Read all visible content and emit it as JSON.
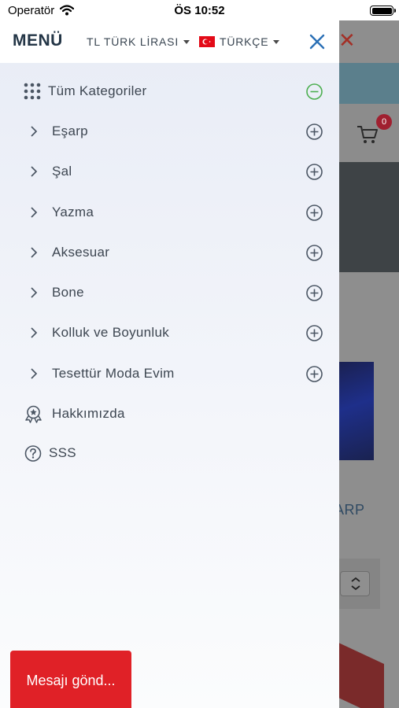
{
  "status_bar": {
    "carrier": "Operatör",
    "time": "ÖS 10:52"
  },
  "drawer": {
    "title": "MENÜ",
    "currency_label": "TL TÜRK LİRASI",
    "language_label": "TÜRKÇE",
    "items": [
      {
        "label": "Tüm Kategoriler",
        "icon": "grid-icon",
        "expanded": true
      },
      {
        "label": "Eşarp",
        "icon": "chevron-right-icon",
        "expanded": false
      },
      {
        "label": "Şal",
        "icon": "chevron-right-icon",
        "expanded": false
      },
      {
        "label": "Yazma",
        "icon": "chevron-right-icon",
        "expanded": false
      },
      {
        "label": "Aksesuar",
        "icon": "chevron-right-icon",
        "expanded": false
      },
      {
        "label": "Bone",
        "icon": "chevron-right-icon",
        "expanded": false
      },
      {
        "label": "Kolluk ve Boyunluk",
        "icon": "chevron-right-icon",
        "expanded": false
      },
      {
        "label": "Tesettür Moda Evim",
        "icon": "chevron-right-icon",
        "expanded": false
      },
      {
        "label": "Hakkımızda",
        "icon": "award-icon"
      },
      {
        "label": "SSS",
        "icon": "question-circle-icon"
      }
    ]
  },
  "background": {
    "cart_count": "0",
    "partial_title": "ARP"
  },
  "message_button": {
    "label": "Mesajı gönd..."
  },
  "colors": {
    "accent_red": "#e02127",
    "minus_green": "#4caf50",
    "close_blue": "#2a6fb5",
    "text": "#3d4651"
  }
}
